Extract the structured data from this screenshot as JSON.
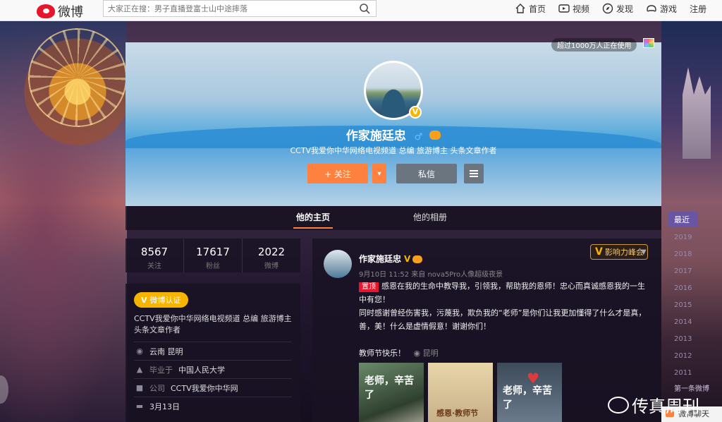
{
  "topbar": {
    "logo_text": "微博",
    "search_placeholder": "大家正在搜：男子直播登富士山中途摔落",
    "nav": [
      "首页",
      "视频",
      "发现",
      "游戏",
      "注册"
    ]
  },
  "cover": {
    "usage_text": "超过1000万人正在使用",
    "name": "作家施廷忠",
    "verified_mark": "V",
    "bio": "CCTV我爱你中华网络电视频道 总编 旅游博主 头条文章作者",
    "follow_label": "+ 关注",
    "more_label": "▾",
    "message_label": "私信"
  },
  "tabs": [
    "他的主页",
    "他的相册"
  ],
  "stats": [
    {
      "num": "8567",
      "label": "关注"
    },
    {
      "num": "17617",
      "label": "粉丝"
    },
    {
      "num": "2022",
      "label": "微博"
    }
  ],
  "profile": {
    "verify_badge": "微博认证",
    "verify_mark": "V",
    "description": "CCTV我爱你中华网络电视频道 总编 旅游博主 头条文章作者",
    "location": "云南 昆明",
    "school_prefix": "毕业于",
    "school": "中国人民大学",
    "company_prefix": "公司",
    "company": "CCTV我爱你中华网",
    "birthday": "3月13日"
  },
  "post": {
    "author": "作家施廷忠",
    "verified_mark": "V",
    "meta": "9月10日 11:52 来自 nova5Pro人像超级夜景",
    "topic_badge": "影响力峰会",
    "topic_mark": "V",
    "pin_label": "置顶",
    "text_1": "感恩在我的生命中教导我，引领我，帮助我的恩师！忠心而真诚感恩我的一生中有您！",
    "text_2": "同时感谢曾经伤害我，污蔑我，欺负我的“老师”是你们让我更加懂得了什么才是真，善，美！什么是虚情假意！谢谢你们！",
    "tail": "教师节快乐！",
    "location": "昆明",
    "thumbs": [
      {
        "text": "老师，辛苦了"
      },
      {
        "text": "感恩·教师节"
      },
      {
        "text": "老师，辛苦了"
      }
    ]
  },
  "timeline": {
    "recent": "最近",
    "years": [
      "2019",
      "2018",
      "2017",
      "2016",
      "2015",
      "2014",
      "2013",
      "2012",
      "2011"
    ],
    "first": "第一条微博"
  },
  "chat_label": "微博聊天",
  "watermark": "传真周刊"
}
